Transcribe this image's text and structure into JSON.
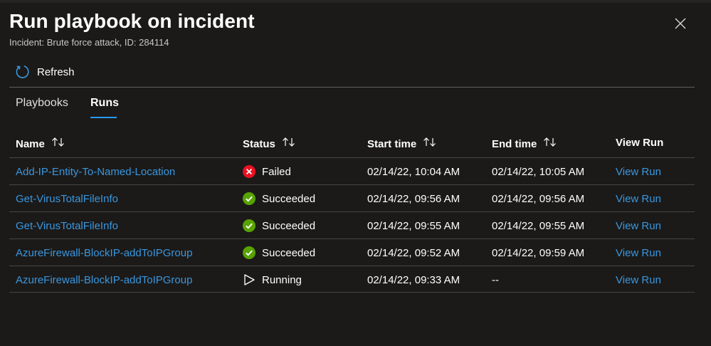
{
  "panel": {
    "title": "Run playbook on incident",
    "subtitle": "Incident: Brute force attack, ID: 284114"
  },
  "toolbar": {
    "refresh_label": "Refresh"
  },
  "tabs": [
    {
      "label": "Playbooks",
      "selected": false
    },
    {
      "label": "Runs",
      "selected": true
    }
  ],
  "table": {
    "columns": [
      "Name",
      "Status",
      "Start time",
      "End time",
      "View Run"
    ],
    "rows": [
      {
        "name": "Add-IP-Entity-To-Named-Location",
        "status": "Failed",
        "status_icon": "error-circle-icon",
        "start": "02/14/22, 10:04 AM",
        "end": "02/14/22, 10:05 AM",
        "view": "View Run"
      },
      {
        "name": "Get-VirusTotalFileInfo",
        "status": "Succeeded",
        "status_icon": "success-check-icon",
        "start": "02/14/22, 09:56 AM",
        "end": "02/14/22, 09:56 AM",
        "view": "View Run"
      },
      {
        "name": "Get-VirusTotalFileInfo",
        "status": "Succeeded",
        "status_icon": "success-check-icon",
        "start": "02/14/22, 09:55 AM",
        "end": "02/14/22, 09:55 AM",
        "view": "View Run"
      },
      {
        "name": "AzureFirewall-BlockIP-addToIPGroup",
        "status": "Succeeded",
        "status_icon": "success-check-icon",
        "start": "02/14/22, 09:52 AM",
        "end": "02/14/22, 09:59 AM",
        "view": "View Run"
      },
      {
        "name": "AzureFirewall-BlockIP-addToIPGroup",
        "status": "Running",
        "status_icon": "play-outline-icon",
        "start": "02/14/22, 09:33 AM",
        "end": "--",
        "view": "View Run"
      }
    ]
  },
  "colors": {
    "background": "#1b1a19",
    "link": "#3a96dd",
    "accent_underline": "#2899f5",
    "failed": "#e81123",
    "succeeded": "#57a300"
  },
  "icons": {
    "close": "close-icon",
    "refresh": "refresh-icon",
    "sort": "sort-arrows-icon"
  }
}
